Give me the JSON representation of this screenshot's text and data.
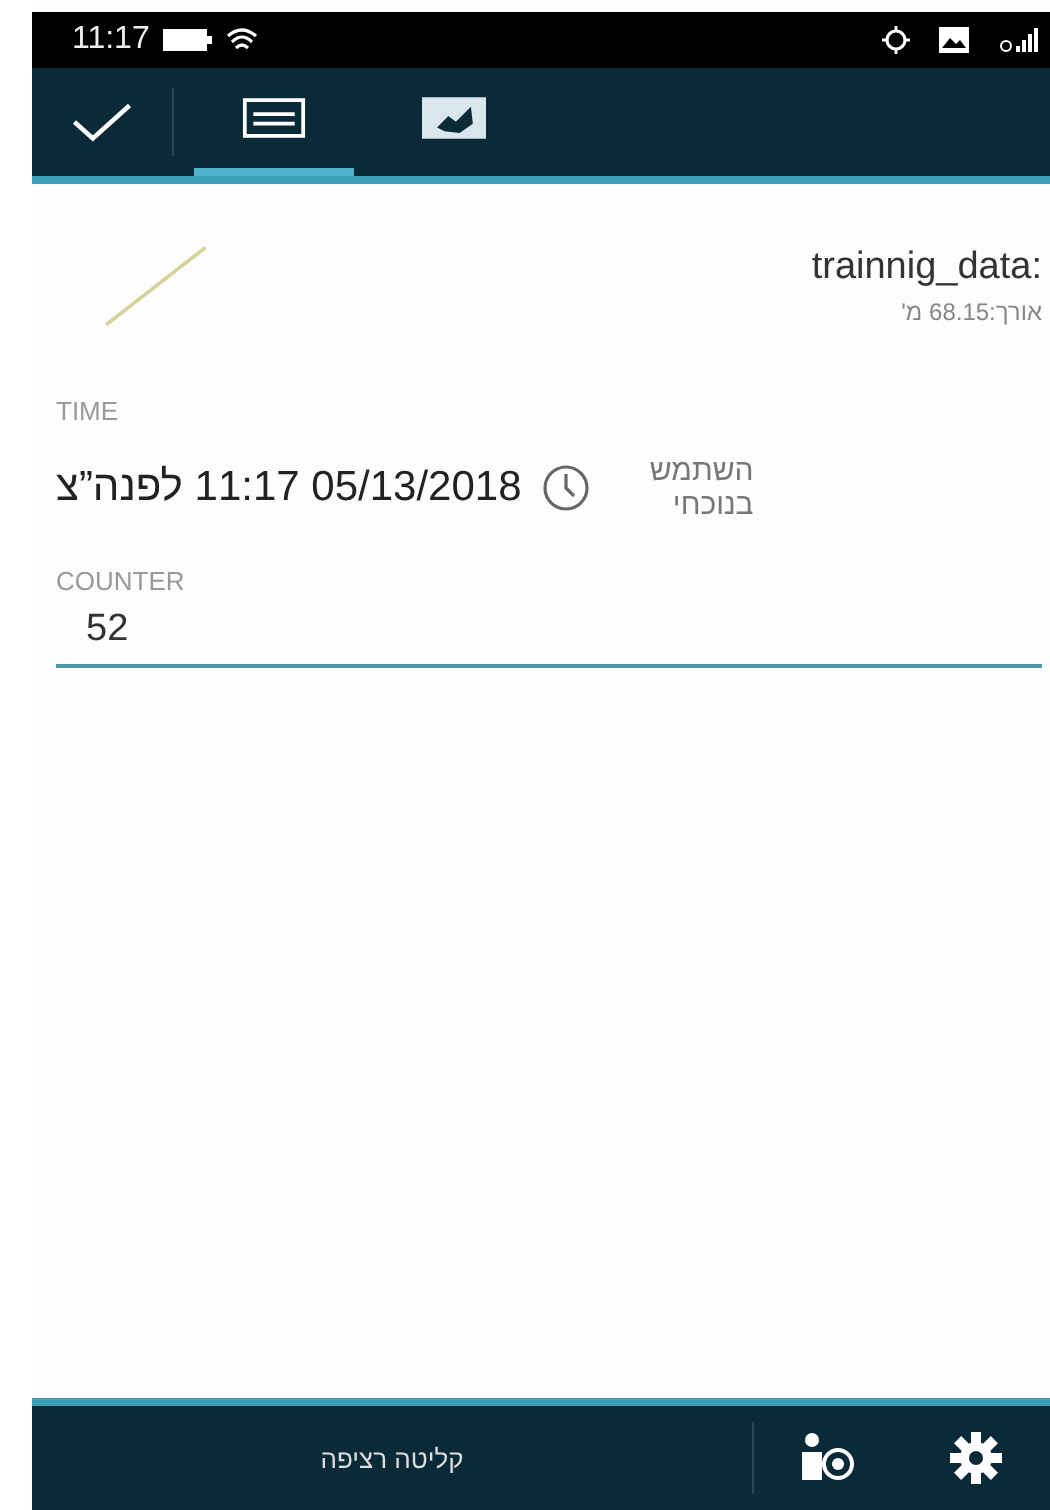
{
  "status_bar": {
    "time": "11:17"
  },
  "toolbar": {
    "tabs": [
      {
        "kind": "form",
        "selected": true
      },
      {
        "kind": "map",
        "selected": false
      }
    ]
  },
  "feature": {
    "name": "trainnig_data:",
    "length": "אורך:68.15 מ'"
  },
  "time_field": {
    "label": "TIME",
    "value": "05/13/2018 11:17 לפנה”צ",
    "now_button": "השתמש בנוכחי"
  },
  "counter_field": {
    "label": "COUNTER",
    "value": "52"
  },
  "bottom_bar": {
    "label": "קליטה רציפה"
  }
}
